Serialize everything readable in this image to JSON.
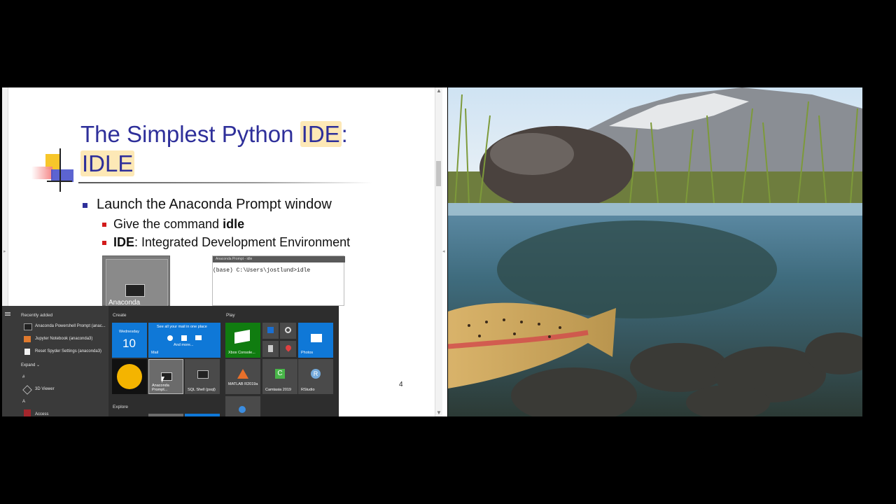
{
  "slide": {
    "title_part1": "The Simplest Python ",
    "title_highlight": "IDE",
    "title_colon": ":",
    "title_line2": "IDLE",
    "bullet_main": "Launch the Anaconda Prompt window",
    "sub1_prefix": "Give the command ",
    "sub1_bold": "idle",
    "sub2_bold": "IDE",
    "sub2_rest": ": Integrated Development Environment",
    "page_number": "4",
    "tile_thumb_label": "Anaconda",
    "console_titlebar_text": "Anaconda Prompt - idle",
    "console_text": "(base) C:\\Users\\jostlund>idle"
  },
  "start_menu": {
    "recently_added_label": "Recently added",
    "recent_items": [
      "Anaconda Powershell Prompt (anac...",
      "Jupyter Notebook (anaconda3)",
      "Reset Spyder Settings (anaconda3)"
    ],
    "expand_label": "Expand",
    "hash_label": "#",
    "app_3d_viewer": "3D Viewer",
    "letter_a": "A",
    "app_access": "Access",
    "create_label": "Create",
    "play_label": "Play",
    "explore_label": "Explore",
    "calendar_day": "Wednesday",
    "calendar_date": "10",
    "mail_header": "See all your mail in one place",
    "mail_more": "And more...",
    "mail_label": "Mail",
    "xbox_label": "Xbox Console...",
    "photos_label": "Photos",
    "anaconda_prompt_label": "Anaconda Prompt...",
    "sql_shell_label": "SQL Shell (psql)",
    "matlab_label": "MATLAB R2019a",
    "camtasia_label": "Camtasia 2019",
    "rstudio_label": "RStudio"
  },
  "colors": {
    "title": "#2e2f9a",
    "highlight": "#fde8b6",
    "tile_blue": "#0f78d7",
    "tile_green": "#107c10"
  }
}
